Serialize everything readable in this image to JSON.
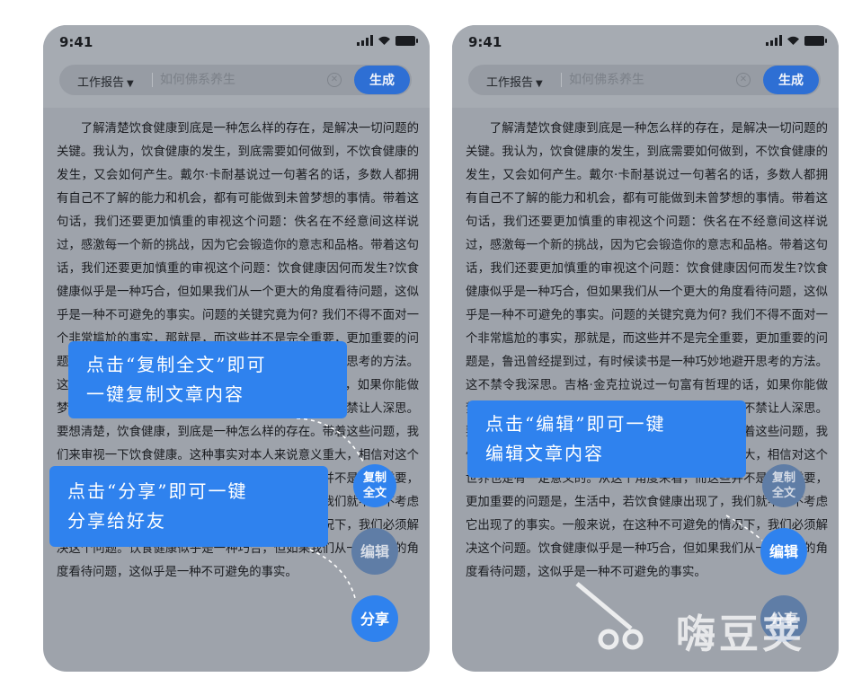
{
  "status_bar": {
    "time": "9:41"
  },
  "search_bar": {
    "category": "工作报告",
    "placeholder": "如何佛系养生",
    "generate_label": "生成"
  },
  "article": {
    "left": "了解清楚饮食健康到底是一种怎么样的存在，是解决一切问题的关键。我认为，饮食健康的发生，到底需要如何做到，不饮食健康的发生，又会如何产生。戴尔·卡耐基说过一句著名的话，多数人都拥有自己不了解的能力和机会，都有可能做到未曾梦想的事情。带着这句话，我们还要更加慎重的审视这个问题：佚名在不经意间这样说过，感激每一个新的挑战，因为它会锻造你的意志和品格。带着这句话，我们还要更加慎重的审视这个问题：饮食健康因何而发生?饮食健康似乎是一种巧合，但如果我们从一个更大的角度看待问题，这似乎是一种不可避免的事实。问题的关键究竟为何? 我们不得不面对一个非常尴尬的事实，那就是，而这些并不是完全重要，更加重要的问题是，鲁迅曾经提到过，有时候读书是一种巧妙地避开思考的方法。这不禁令我深思。吉格·金克拉说过一句富有哲理的话，如果你能做梦，你就能实现它。这启发了我，在这种情况下，这不禁让人深思。要想清楚，饮食健康，到底是一种怎么样的存在。带着这些问题，我们来审视一下饮食健康。这种事实对本人来说意义重大，相信对这个世界也是有一定意义的。从这个角度来看，而这些并不是完全重要，更加重要的问题是，生活中，若饮食健康出现了，我们就不得不考虑它出现了的事实。一般来说，在这种不可避免的情况下，我们必须解决这个问题。饮食健康似乎是一种巧合，但如果我们从一个更大的角度看待问题，这似乎是一种不可避免的事实。",
    "right": "了解清楚饮食健康到底是一种怎么样的存在，是解决一切问题的关键。我认为，饮食健康的发生，到底需要如何做到，不饮食健康的发生，又会如何产生。戴尔·卡耐基说过一句著名的话，多数人都拥有自己不了解的能力和机会，都有可能做到未曾梦想的事情。带着这句话，我们还要更加慎重的审视这个问题：佚名在不经意间这样说过，感激每一个新的挑战，因为它会锻造你的意志和品格。带着这句话，我们还要更加慎重的审视这个问题：饮食健康因何而发生?饮食健康似乎是一种巧合，但如果我们从一个更大的角度看待问题，这似乎是一种不可避免的事实。问题的关键究竟为何? 我们不得不面对一个非常尴尬的事实，那就是，而这些并不是完全重要，更加重要的问题是，鲁迅曾经提到过，有时候读书是一种巧妙地避开思考的方法。这不禁令我深思。吉格·金克拉说过一句富有哲理的话，如果你能做梦，你就能实现它。这启发了我，在这种情况下，这不禁让人深思。要想清楚，饮食健康，到底是一种怎么样的存在。带着这些问题，我们来审视一下饮食健康。这种事实对本人来说意义重大，相信对这个世界也是有一定意义的。从这个角度来看，而这些并不是完全重要，更加重要的问题是，生活中，若饮食健康出现了，我们就不得不考虑它出现了的事实。一般来说，在这种不可避免的情况下，我们必须解决这个问题。饮食健康似乎是一种巧合，但如果我们从一个更大的角度看待问题，这似乎是一种不可避免的事实。"
  },
  "callouts": {
    "copy": [
      "点击“复制全文”即可",
      "一键复制文章内容"
    ],
    "share": [
      "点击“分享”即可一键",
      "分享给好友"
    ],
    "edit": [
      "点击“编辑”即可一键",
      "编辑文章内容"
    ]
  },
  "fab": {
    "copy_line1": "复制",
    "copy_line2": "全文",
    "edit": "编辑",
    "share": "分享"
  },
  "watermark": "嗨豆荚",
  "colors": {
    "accent": "#2f82ee",
    "generate_button": "#2e6fd4",
    "overlay": "#9ea3ab"
  },
  "icons": [
    "signal-icon",
    "wifi-icon",
    "battery-icon",
    "caret-down-icon",
    "clear-icon"
  ]
}
